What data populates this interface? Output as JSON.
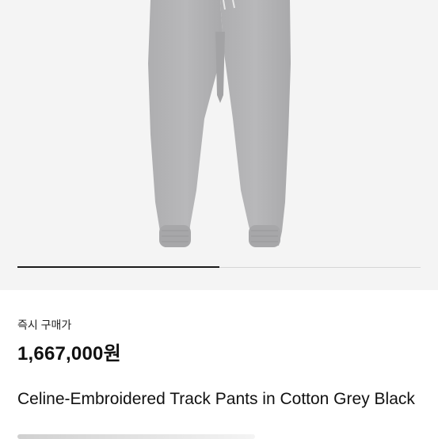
{
  "product": {
    "image_icon": "grey-track-pants-image",
    "image_count_progress": 0.5
  },
  "listing": {
    "purchase_type": "즉시 구매가",
    "price": "1,667,000원",
    "title": "Celine-Embroidered Track Pants in Cotton Grey Black"
  },
  "colors": {
    "pants": "#b3b3b5",
    "background": "#f4f4f4",
    "progress": "#1a1a1a"
  }
}
